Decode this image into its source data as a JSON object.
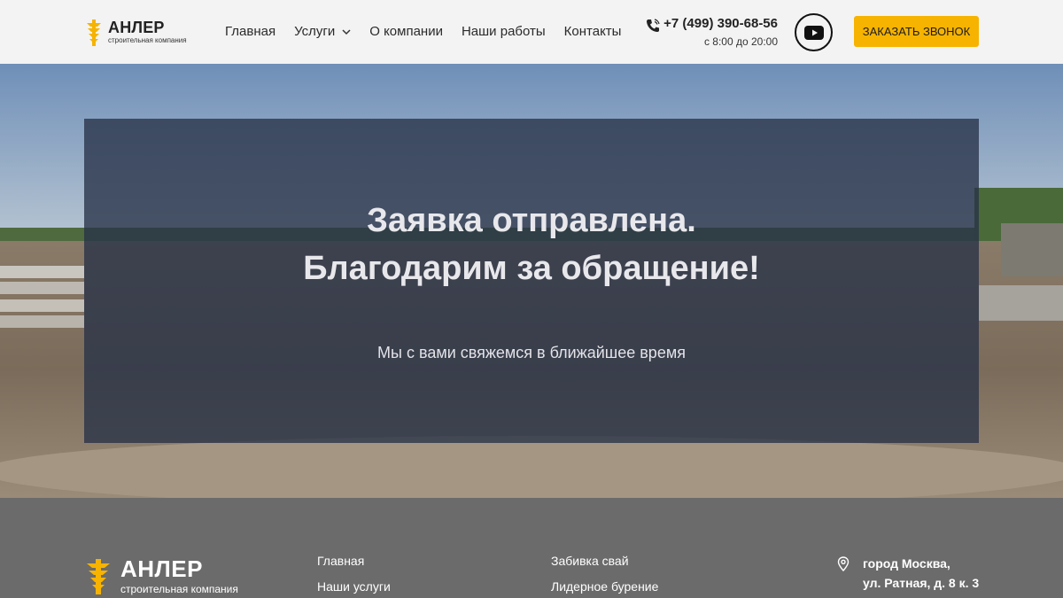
{
  "header": {
    "logo": {
      "name": "АНЛЕР",
      "tagline": "строительная компания"
    },
    "nav": [
      {
        "label": "Главная"
      },
      {
        "label": "Услуги",
        "has_dropdown": true
      },
      {
        "label": "О компании"
      },
      {
        "label": "Наши работы"
      },
      {
        "label": "Контакты"
      }
    ],
    "phone": {
      "number": "+7 (499) 390-68-56",
      "hours": "с 8:00 до 20:00",
      "icon": "phone-icon"
    },
    "youtube_icon": "youtube-icon",
    "cta_label": "ЗАКАЗАТЬ ЗВОНОК"
  },
  "hero": {
    "title_line1": "Заявка отправлена.",
    "title_line2": "Благодарим за обращение!",
    "subtitle": "Мы с вами свяжемся в ближайшее время"
  },
  "footer": {
    "logo": {
      "name": "АНЛЕР",
      "tagline": "строительная компания"
    },
    "col1": [
      "Главная",
      "Наши услуги"
    ],
    "col2": [
      "Забивка свай",
      "Лидерное бурение"
    ],
    "address": {
      "line1": "город Москва,",
      "line2": "ул. Ратная, д. 8 к. 3",
      "icon": "location-pin-icon"
    }
  },
  "colors": {
    "accent": "#f6b300",
    "header_bg": "#f3f3f3",
    "panel_overlay": "#283248",
    "footer_bg": "#6b6b6b"
  }
}
